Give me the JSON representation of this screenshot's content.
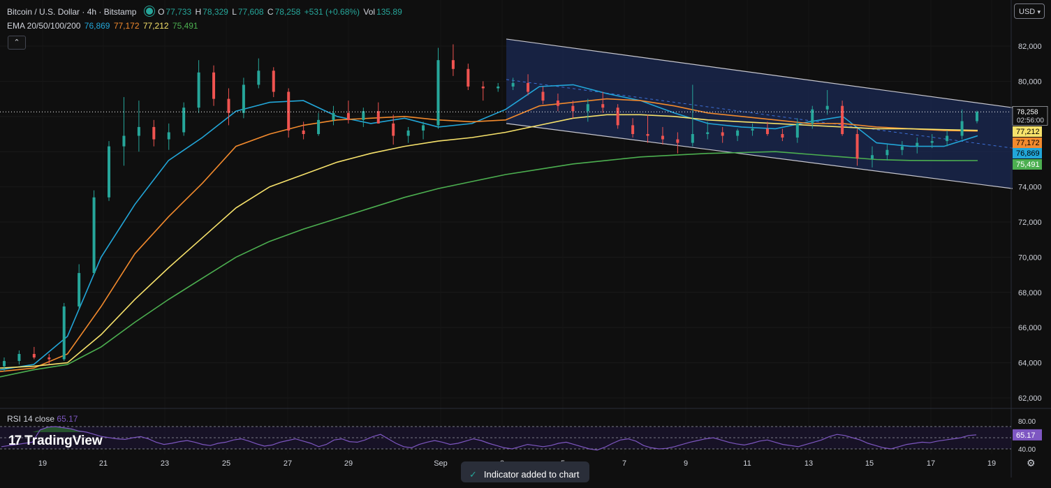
{
  "header": {
    "symbol": "Bitcoin / U.S. Dollar · 4h · Bitstamp",
    "o_label": "O",
    "o_value": "77,733",
    "h_label": "H",
    "h_value": "78,329",
    "l_label": "L",
    "l_value": "77,608",
    "c_label": "C",
    "c_value": "78,258",
    "change": "+531 (+0.68%)",
    "vol_label": "Vol",
    "vol_value": "135.89"
  },
  "ema_legend": {
    "label": "EMA 20/50/100/200",
    "values": [
      "76,869",
      "77,172",
      "77,212",
      "75,491"
    ],
    "colors": [
      "#22a6d8",
      "#f28a2d",
      "#f7e26b",
      "#4caf50"
    ]
  },
  "currency": "USD",
  "collapse_icon": "chevron-up-icon",
  "rsi": {
    "label": "RSI 14 close",
    "value": "65.17",
    "color": "#7e57c2"
  },
  "logo": {
    "mark": "17",
    "text": "TradingView"
  },
  "toast": {
    "text": "Indicator added to chart"
  },
  "colors": {
    "up": "#26a69a",
    "down": "#ef5350",
    "background": "#0f0f0f",
    "channel": "#1b2a54"
  },
  "chart_data": {
    "type": "candlestick",
    "title": "Bitcoin / U.S. Dollar · 4h · Bitstamp",
    "y_ticks": [
      82000,
      80000,
      78000,
      76000,
      74000,
      72000,
      70000,
      68000,
      66000,
      64000,
      62000
    ],
    "y_tick_labels": [
      "82,000",
      "80,000",
      "78,000",
      "76,000",
      "74,000",
      "72,000",
      "70,000",
      "68,000",
      "66,000",
      "64,000",
      "62,000"
    ],
    "ylim": [
      61700,
      83100
    ],
    "x_ticks": [
      "19",
      "21",
      "23",
      "25",
      "27",
      "29",
      "Sep",
      "3",
      "5",
      "7",
      "9",
      "11",
      "13",
      "15",
      "17",
      "19"
    ],
    "current_price": {
      "value": 78258,
      "label": "78,258",
      "countdown": "02:56:00"
    },
    "price_labels": [
      {
        "label": "77,212",
        "value": 77212,
        "color": "#f7e26b"
      },
      {
        "label": "77,172",
        "value": 77172,
        "color": "#f28a2d"
      },
      {
        "label": "76,869",
        "value": 76869,
        "color": "#22a6d8"
      },
      {
        "label": "75,491",
        "value": 75491,
        "color": "#4caf50"
      }
    ],
    "ema_series": [
      {
        "name": "EMA 20",
        "color": "#22a6d8",
        "points": [
          [
            0,
            63600
          ],
          [
            1,
            63900
          ],
          [
            2,
            65500
          ],
          [
            3,
            70000
          ],
          [
            4,
            73000
          ],
          [
            5,
            75500
          ],
          [
            6,
            76800
          ],
          [
            7,
            78300
          ],
          [
            8,
            78800
          ],
          [
            9,
            78900
          ],
          [
            10,
            78000
          ],
          [
            11,
            77600
          ],
          [
            12,
            77900
          ],
          [
            13,
            77400
          ],
          [
            14,
            77600
          ],
          [
            15,
            78400
          ],
          [
            16,
            79700
          ],
          [
            17,
            79800
          ],
          [
            18,
            79300
          ],
          [
            19,
            78900
          ],
          [
            20,
            78200
          ],
          [
            21,
            77600
          ],
          [
            22,
            77400
          ],
          [
            23,
            77300
          ],
          [
            24,
            77700
          ],
          [
            25,
            78000
          ],
          [
            26,
            76500
          ],
          [
            27,
            76300
          ],
          [
            28,
            76300
          ],
          [
            29,
            76900
          ]
        ]
      },
      {
        "name": "EMA 50",
        "color": "#f28a2d",
        "points": [
          [
            0,
            63500
          ],
          [
            1,
            63700
          ],
          [
            2,
            64500
          ],
          [
            3,
            67200
          ],
          [
            4,
            70200
          ],
          [
            5,
            72300
          ],
          [
            6,
            74200
          ],
          [
            7,
            76300
          ],
          [
            8,
            77000
          ],
          [
            9,
            77500
          ],
          [
            10,
            77800
          ],
          [
            11,
            77900
          ],
          [
            12,
            78000
          ],
          [
            13,
            77800
          ],
          [
            14,
            77700
          ],
          [
            15,
            77800
          ],
          [
            16,
            78600
          ],
          [
            17,
            78800
          ],
          [
            18,
            79000
          ],
          [
            19,
            78900
          ],
          [
            20,
            78600
          ],
          [
            21,
            78200
          ],
          [
            22,
            78000
          ],
          [
            23,
            77800
          ],
          [
            24,
            77600
          ],
          [
            25,
            77600
          ],
          [
            26,
            77400
          ],
          [
            27,
            77300
          ],
          [
            28,
            77200
          ],
          [
            29,
            77172
          ]
        ]
      },
      {
        "name": "EMA 100",
        "color": "#f7e26b",
        "points": [
          [
            0,
            63700
          ],
          [
            1,
            63800
          ],
          [
            2,
            64000
          ],
          [
            3,
            65600
          ],
          [
            4,
            67600
          ],
          [
            5,
            69400
          ],
          [
            6,
            71100
          ],
          [
            7,
            72800
          ],
          [
            8,
            74000
          ],
          [
            9,
            74700
          ],
          [
            10,
            75400
          ],
          [
            11,
            75900
          ],
          [
            12,
            76300
          ],
          [
            13,
            76600
          ],
          [
            14,
            76800
          ],
          [
            15,
            77100
          ],
          [
            16,
            77500
          ],
          [
            17,
            77900
          ],
          [
            18,
            78100
          ],
          [
            19,
            78100
          ],
          [
            20,
            78000
          ],
          [
            21,
            77800
          ],
          [
            22,
            77700
          ],
          [
            23,
            77600
          ],
          [
            24,
            77500
          ],
          [
            25,
            77400
          ],
          [
            26,
            77300
          ],
          [
            27,
            77300
          ],
          [
            28,
            77250
          ],
          [
            29,
            77212
          ]
        ]
      },
      {
        "name": "EMA 200",
        "color": "#4caf50",
        "points": [
          [
            0,
            63200
          ],
          [
            1,
            63600
          ],
          [
            2,
            63900
          ],
          [
            3,
            64900
          ],
          [
            4,
            66300
          ],
          [
            5,
            67600
          ],
          [
            6,
            68800
          ],
          [
            7,
            70000
          ],
          [
            8,
            70900
          ],
          [
            9,
            71600
          ],
          [
            10,
            72200
          ],
          [
            11,
            72800
          ],
          [
            12,
            73400
          ],
          [
            13,
            73900
          ],
          [
            14,
            74300
          ],
          [
            15,
            74700
          ],
          [
            16,
            75000
          ],
          [
            17,
            75300
          ],
          [
            18,
            75500
          ],
          [
            19,
            75700
          ],
          [
            20,
            75800
          ],
          [
            21,
            75900
          ],
          [
            22,
            75950
          ],
          [
            23,
            76000
          ],
          [
            24,
            75850
          ],
          [
            25,
            75700
          ],
          [
            26,
            75550
          ],
          [
            27,
            75500
          ],
          [
            28,
            75490
          ],
          [
            29,
            75491
          ]
        ]
      }
    ],
    "candles": [
      [
        63800,
        64300,
        63500,
        64100
      ],
      [
        64100,
        64700,
        63900,
        64500
      ],
      [
        64500,
        64900,
        64200,
        64300
      ],
      [
        64300,
        64500,
        63900,
        64200
      ],
      [
        64200,
        67400,
        64100,
        67200
      ],
      [
        67200,
        69600,
        67000,
        69100
      ],
      [
        69100,
        73800,
        69000,
        73400
      ],
      [
        73400,
        76600,
        73200,
        76300
      ],
      [
        76300,
        79100,
        75200,
        76900
      ],
      [
        76900,
        78900,
        76000,
        77400
      ],
      [
        77400,
        77800,
        76300,
        76700
      ],
      [
        76700,
        77600,
        76100,
        77100
      ],
      [
        77100,
        78800,
        76900,
        78500
      ],
      [
        78500,
        81200,
        78200,
        80500
      ],
      [
        80500,
        80900,
        78600,
        79000
      ],
      [
        79000,
        79600,
        77500,
        78200
      ],
      [
        78200,
        80200,
        77900,
        79800
      ],
      [
        79800,
        81300,
        79600,
        80600
      ],
      [
        80600,
        80800,
        79100,
        79400
      ],
      [
        79400,
        79600,
        76800,
        77200
      ],
      [
        77200,
        77700,
        76700,
        77000
      ],
      [
        77000,
        78200,
        76900,
        77800
      ],
      [
        77800,
        78600,
        77500,
        78200
      ],
      [
        78200,
        78900,
        77600,
        77800
      ],
      [
        77800,
        78500,
        77400,
        78300
      ],
      [
        78300,
        78800,
        77600,
        77600
      ],
      [
        77600,
        78100,
        76400,
        76900
      ],
      [
        76900,
        77400,
        76500,
        77200
      ],
      [
        77200,
        77700,
        76700,
        77500
      ],
      [
        77500,
        81900,
        77300,
        81200
      ],
      [
        81200,
        82100,
        80300,
        80700
      ],
      [
        80700,
        81000,
        79500,
        79700
      ],
      [
        79700,
        80000,
        78900,
        79600
      ],
      [
        79600,
        79900,
        79400,
        79700
      ],
      [
        79700,
        80200,
        79500,
        79900
      ],
      [
        79900,
        80400,
        79200,
        79400
      ],
      [
        79400,
        79700,
        78700,
        78900
      ],
      [
        78900,
        79300,
        78300,
        78600
      ],
      [
        78600,
        78900,
        77900,
        78300
      ],
      [
        78300,
        79000,
        77700,
        78700
      ],
      [
        78700,
        79400,
        78200,
        78500
      ],
      [
        78500,
        78700,
        77300,
        77500
      ],
      [
        77500,
        77900,
        76800,
        77000
      ],
      [
        77000,
        78100,
        76500,
        76900
      ],
      [
        76900,
        77400,
        76400,
        76700
      ],
      [
        76700,
        77100,
        75900,
        76500
      ],
      [
        76500,
        79800,
        76300,
        77000
      ],
      [
        77000,
        77700,
        76700,
        77100
      ],
      [
        77100,
        77400,
        76500,
        76900
      ],
      [
        76900,
        77300,
        76600,
        77200
      ],
      [
        77200,
        77600,
        76900,
        77300
      ],
      [
        77300,
        77700,
        76900,
        77000
      ],
      [
        77000,
        77300,
        76600,
        76800
      ],
      [
        76800,
        77900,
        76500,
        77600
      ],
      [
        77600,
        78600,
        77300,
        78400
      ],
      [
        78400,
        79500,
        78100,
        78600
      ],
      [
        78600,
        78900,
        76900,
        77000
      ],
      [
        77000,
        77300,
        75200,
        75600
      ],
      [
        75600,
        76300,
        75100,
        75800
      ],
      [
        75800,
        76400,
        75500,
        76100
      ],
      [
        76100,
        76600,
        75800,
        76300
      ],
      [
        76300,
        76800,
        75900,
        76500
      ],
      [
        76500,
        77000,
        76200,
        76600
      ],
      [
        76600,
        77200,
        76300,
        76900
      ],
      [
        76900,
        78400,
        76700,
        77733
      ],
      [
        77733,
        78329,
        77608,
        78258
      ]
    ],
    "channel": {
      "upper": [
        [
          725,
          82400
        ],
        [
          1450,
          78500
        ]
      ],
      "lower": [
        [
          725,
          77600
        ],
        [
          1450,
          73900
        ]
      ],
      "mid": [
        [
          725,
          80100
        ],
        [
          1450,
          76200
        ]
      ]
    },
    "rsi": {
      "levels": [
        80,
        60,
        40
      ],
      "level_labels": [
        "80.00",
        "40.00"
      ],
      "values": [
        44,
        46,
        48,
        50,
        52,
        74,
        79,
        80,
        78,
        76,
        72,
        70,
        66,
        62,
        60,
        58,
        57,
        60,
        62,
        58,
        52,
        48,
        50,
        53,
        55,
        52,
        48,
        46,
        50,
        52,
        56,
        58,
        54,
        49,
        45,
        47,
        52,
        55,
        58,
        54,
        50,
        44,
        48,
        56,
        58,
        53,
        52,
        56,
        62,
        66,
        58,
        50,
        44,
        42,
        48,
        52,
        55,
        52,
        48,
        50,
        54,
        58,
        55,
        50,
        46,
        42,
        40,
        44,
        48,
        46,
        44,
        46,
        50,
        52,
        48,
        44,
        40,
        38,
        43,
        50,
        56,
        58,
        54,
        46,
        42,
        40,
        41,
        44,
        48,
        52,
        55,
        58,
        60,
        56,
        52,
        49,
        47,
        50,
        54,
        56,
        52,
        48,
        46,
        44,
        48,
        52,
        56,
        62,
        66,
        64,
        60,
        56,
        50,
        46,
        42,
        40,
        44,
        48,
        50,
        52,
        51,
        54,
        56,
        58,
        60,
        64,
        65.17
      ],
      "ylim": [
        30,
        90
      ]
    }
  }
}
